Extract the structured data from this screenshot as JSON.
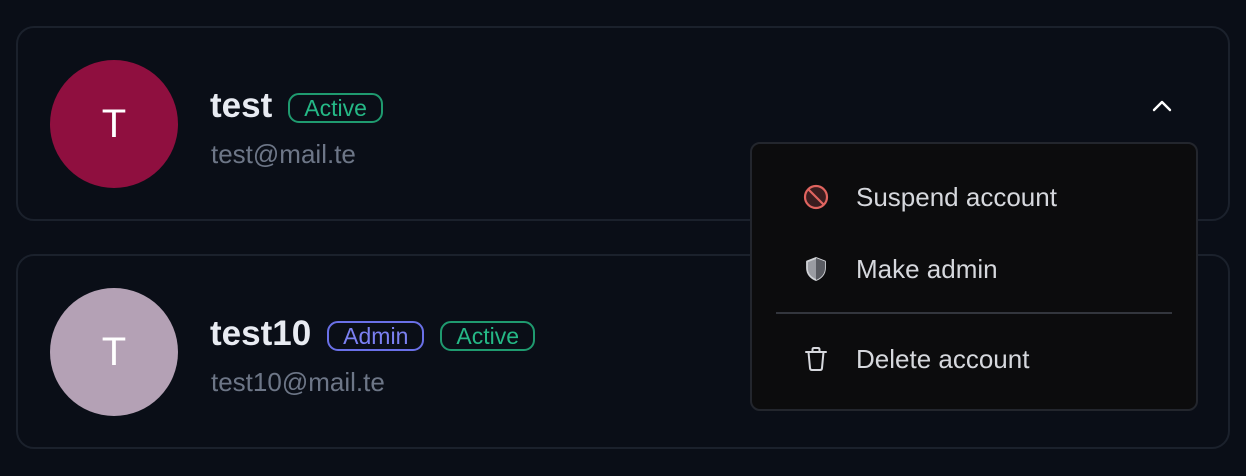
{
  "users": [
    {
      "initial": "T",
      "username": "test",
      "email": "test@mail.te",
      "avatar_color": "#8f0f3f",
      "badges": {
        "active": "Active"
      }
    },
    {
      "initial": "T",
      "username": "test10",
      "email": "test10@mail.te",
      "avatar_color": "#b4a1b5",
      "badges": {
        "admin": "Admin",
        "active": "Active"
      }
    }
  ],
  "menu": {
    "items": [
      {
        "label": "Suspend account",
        "icon": "ban-icon"
      },
      {
        "label": "Make admin",
        "icon": "shield-icon"
      },
      {
        "label": "Delete account",
        "icon": "trash-icon"
      }
    ]
  },
  "colors": {
    "background": "#0a0e17",
    "active_badge": "#25b886",
    "admin_badge": "#7b80f2",
    "suspend_icon": "#e0645f"
  }
}
